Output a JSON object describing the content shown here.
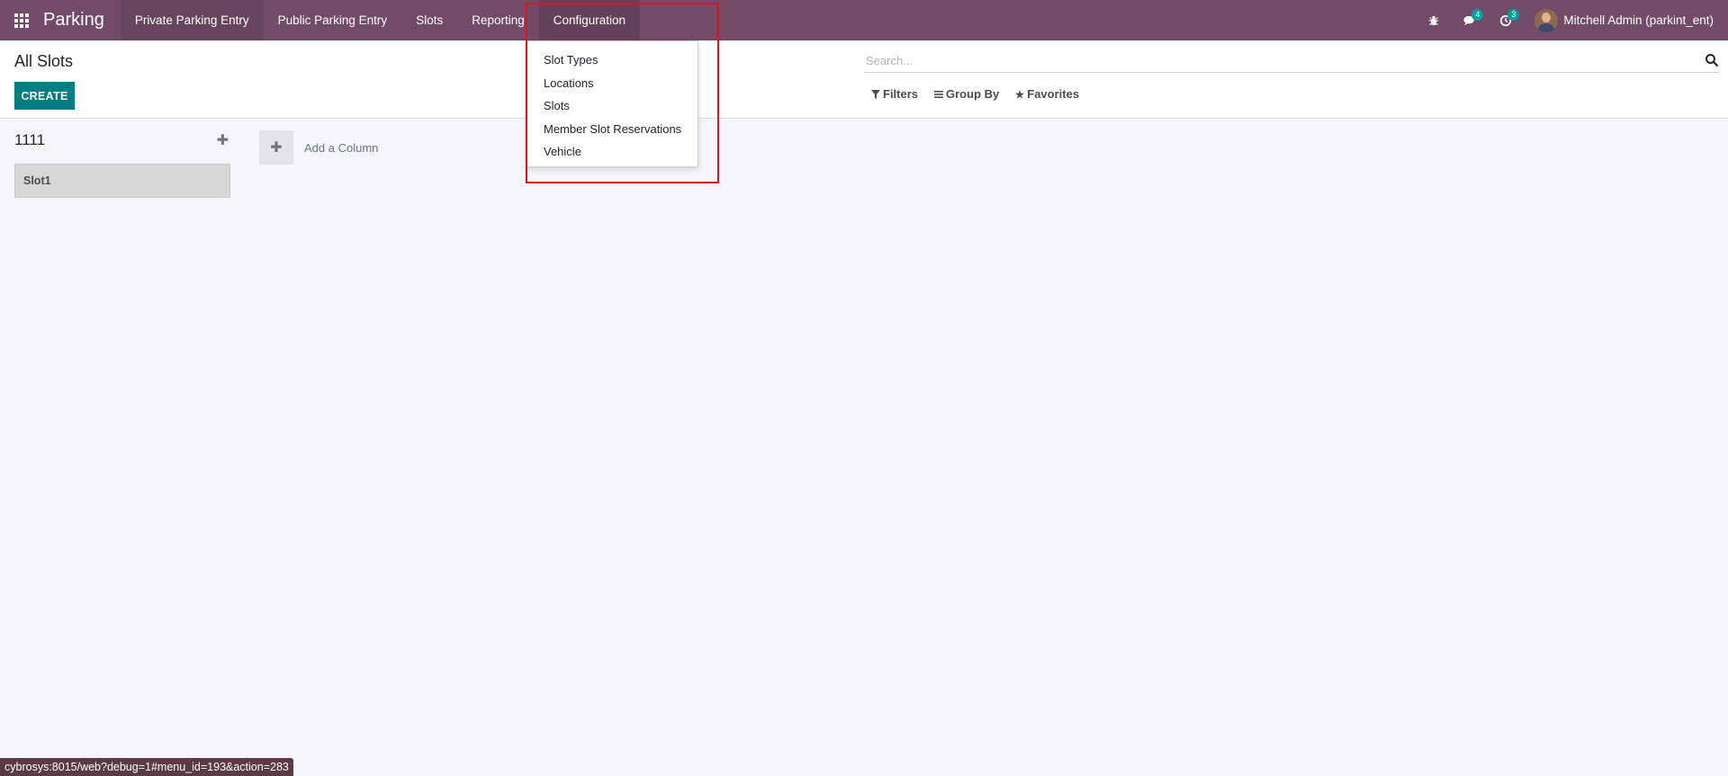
{
  "navbar": {
    "brand": "Parking",
    "menu": [
      {
        "label": "Private Parking Entry"
      },
      {
        "label": "Public Parking Entry"
      },
      {
        "label": "Slots"
      },
      {
        "label": "Reporting"
      },
      {
        "label": "Configuration"
      }
    ],
    "messages_count": "4",
    "activities_count": "3",
    "user_name": "Mitchell Admin (parkint_ent)"
  },
  "control_panel": {
    "title": "All Slots",
    "create_label": "CREATE",
    "search_placeholder": "Search...",
    "filters_label": "Filters",
    "group_by_label": "Group By",
    "favorites_label": "Favorites"
  },
  "kanban": {
    "column_title": "1111",
    "card_label": "Slot1",
    "add_column_label": "Add a Column"
  },
  "dropdown": {
    "items": [
      {
        "label": "Slot Types"
      },
      {
        "label": "Locations"
      },
      {
        "label": "Slots"
      },
      {
        "label": "Member Slot Reservations"
      },
      {
        "label": "Vehicle"
      }
    ]
  },
  "status_bar": {
    "url": "cybrosys:8015/web?debug=1#menu_id=193&action=283"
  },
  "colors": {
    "navbar": "#714b67",
    "primary_button": "#017e84",
    "badge": "#00a09d",
    "highlight": "#e0121c"
  }
}
